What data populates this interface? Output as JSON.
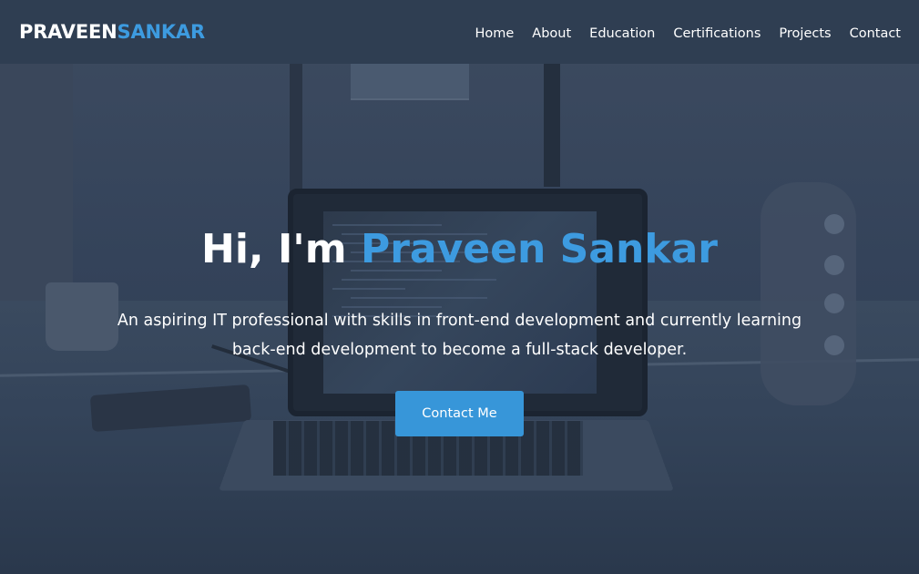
{
  "nav": {
    "logo_first": "PRAVEEN",
    "logo_last": "SANKAR",
    "links": [
      "Home",
      "About",
      "Education",
      "Certifications",
      "Projects",
      "Contact"
    ]
  },
  "hero": {
    "greeting": "Hi, I'm",
    "name": "Praveen Sankar",
    "tagline": "An aspiring IT professional with skills in front-end development and currently learning back-end development to become a full-stack developer.",
    "cta_label": "Contact Me"
  },
  "colors": {
    "accent": "#3d9be0",
    "navbar_bg": "#2f3e52",
    "button_bg": "#3796d9",
    "text": "#ffffff"
  }
}
